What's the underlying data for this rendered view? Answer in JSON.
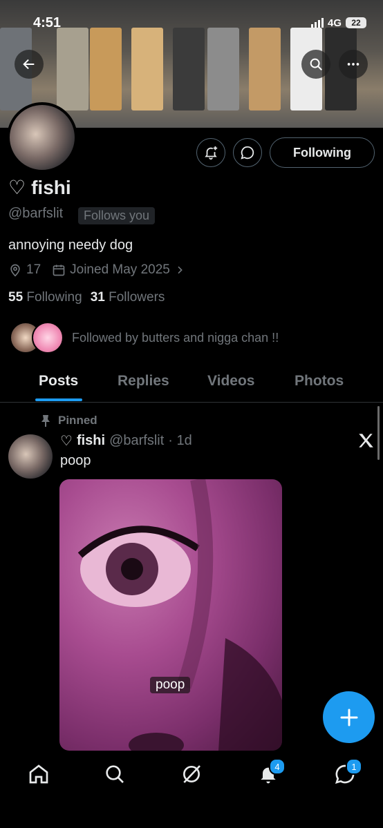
{
  "status_bar": {
    "time": "4:51",
    "network": "4G",
    "battery": "22"
  },
  "header": {
    "back_icon": "arrow-left-icon",
    "search_icon": "search-icon",
    "more_icon": "more-icon"
  },
  "profile": {
    "name": "fishi",
    "name_prefix": "♡",
    "handle": "@barfslit",
    "follows_you": "Follows you",
    "bio": "annoying needy dog",
    "location": "17",
    "joined": "Joined May 2025",
    "following_count": "55",
    "following_label": "Following",
    "followers_count": "31",
    "followers_label": "Followers",
    "followed_by": "Followed by butters and nigga chan !!"
  },
  "actions": {
    "following_button": "Following"
  },
  "tabs": [
    {
      "label": "Posts",
      "active": true
    },
    {
      "label": "Replies",
      "active": false
    },
    {
      "label": "Videos",
      "active": false
    },
    {
      "label": "Photos",
      "active": false
    }
  ],
  "post": {
    "pinned_label": "Pinned",
    "author_name": "fishi",
    "author_prefix": "♡",
    "author_handle": "@barfslit",
    "time": "· 1d",
    "text": "poop",
    "image_caption": "poop"
  },
  "bottom_nav": {
    "notifications_badge": "4",
    "messages_badge": "1"
  },
  "colors": {
    "accent": "#1d9bf0",
    "background": "#000000",
    "muted": "#71767b"
  }
}
